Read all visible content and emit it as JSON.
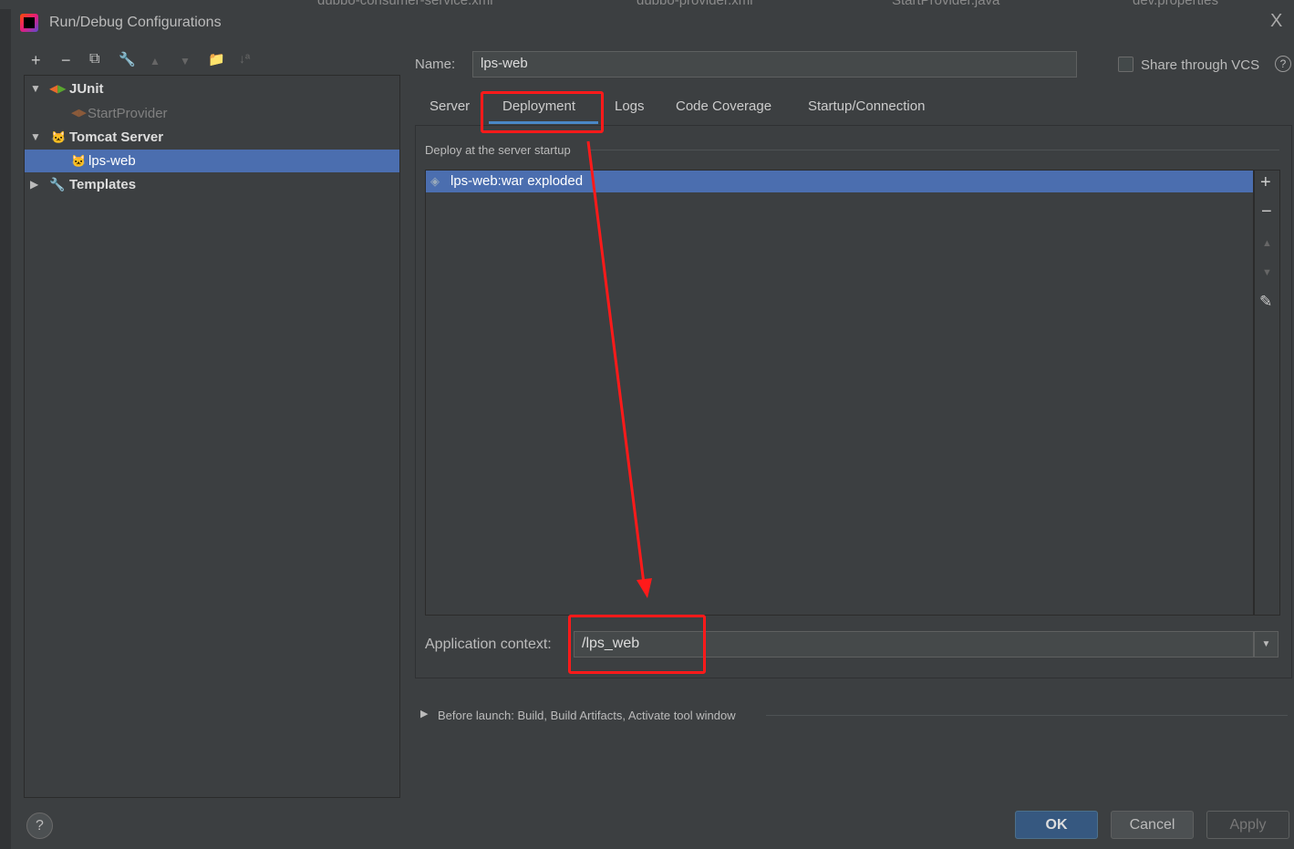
{
  "background_tabs": [
    "dubbo-consumer-service.xml",
    "dubbo-provider.xml",
    "StartProvider.java",
    "dev.properties"
  ],
  "dialog": {
    "title": "Run/Debug Configurations",
    "close": "X"
  },
  "toolbar": {
    "add": "+",
    "remove": "−",
    "copy": "⧉",
    "edit": "🔧",
    "up": "▲",
    "down": "▼",
    "folder": "📁",
    "sort": "↓ª"
  },
  "tree": {
    "junit": "JUnit",
    "start_provider": "StartProvider",
    "tomcat": "Tomcat Server",
    "lps_web": "lps-web",
    "templates": "Templates"
  },
  "form": {
    "name_label": "Name:",
    "name_value": "lps-web",
    "share_label": "Share through VCS",
    "share_checked": false,
    "help": "?"
  },
  "tabs": [
    "Server",
    "Deployment",
    "Logs",
    "Code Coverage",
    "Startup/Connection"
  ],
  "active_tab": "Deployment",
  "deployment": {
    "section_title": "Deploy at the server startup",
    "items": [
      "lps-web:war exploded"
    ],
    "app_context_label": "Application context:",
    "app_context_value": "/lps_web"
  },
  "before_launch": "Before launch: Build, Build Artifacts, Activate tool window",
  "buttons": {
    "ok": "OK",
    "cancel": "Cancel",
    "apply": "Apply",
    "help": "?"
  },
  "colors": {
    "selection": "#4b6eaf",
    "annotation": "#ff1a1a",
    "tab_underline": "#4a88c7"
  }
}
